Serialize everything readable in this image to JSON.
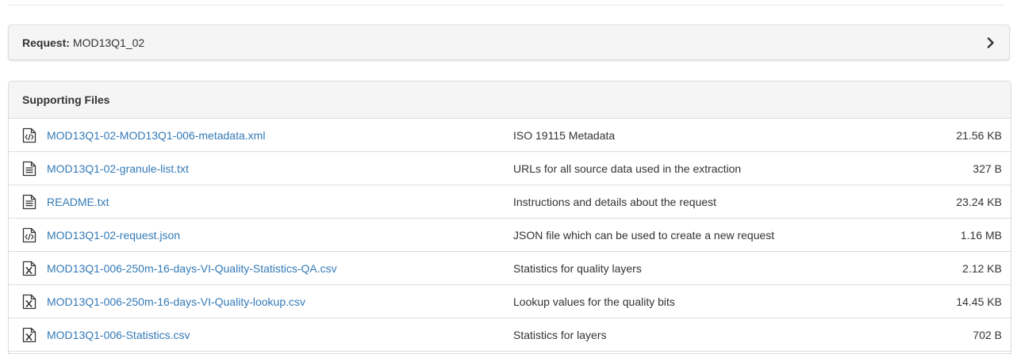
{
  "request": {
    "label": "Request:",
    "value": "MOD13Q1_02"
  },
  "supporting_files": {
    "title": "Supporting Files",
    "files": [
      {
        "icon": "code-file-icon",
        "name": "MOD13Q1-02-MOD13Q1-006-metadata.xml",
        "description": "ISO 19115 Metadata",
        "size": "21.56 KB"
      },
      {
        "icon": "text-file-icon",
        "name": "MOD13Q1-02-granule-list.txt",
        "description": "URLs for all source data used in the extraction",
        "size": "327 B"
      },
      {
        "icon": "text-file-icon",
        "name": "README.txt",
        "description": "Instructions and details about the request",
        "size": "23.24 KB"
      },
      {
        "icon": "code-file-icon",
        "name": "MOD13Q1-02-request.json",
        "description": "JSON file which can be used to create a new request",
        "size": "1.16 MB"
      },
      {
        "icon": "spreadsheet-file-icon",
        "name": "MOD13Q1-006-250m-16-days-VI-Quality-Statistics-QA.csv",
        "description": "Statistics for quality layers",
        "size": "2.12 KB"
      },
      {
        "icon": "spreadsheet-file-icon",
        "name": "MOD13Q1-006-250m-16-days-VI-Quality-lookup.csv",
        "description": "Lookup values for the quality bits",
        "size": "14.45 KB"
      },
      {
        "icon": "spreadsheet-file-icon",
        "name": "MOD13Q1-006-Statistics.csv",
        "description": "Statistics for layers",
        "size": "702 B"
      }
    ]
  },
  "colors": {
    "link": "#337ab7",
    "panel_heading_bg": "#f5f5f5",
    "border": "#dddddd"
  }
}
